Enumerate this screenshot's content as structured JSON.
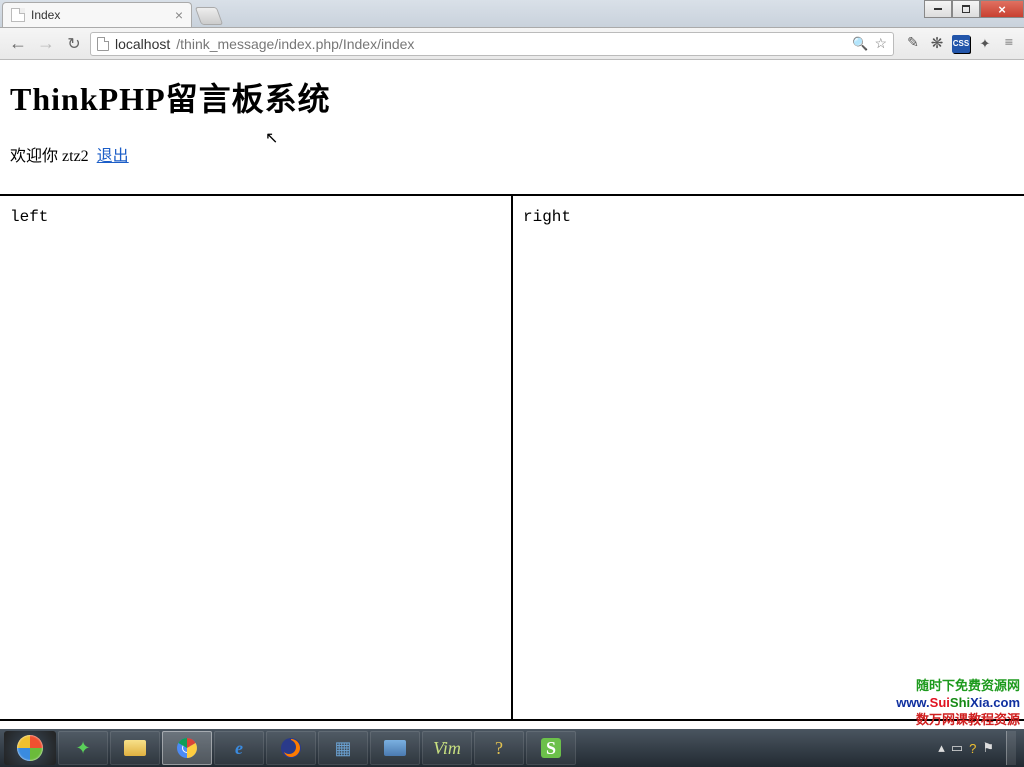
{
  "window": {
    "min_label": "minimize",
    "max_label": "maximize",
    "close_label": "close"
  },
  "tab": {
    "title": "Index"
  },
  "url": {
    "host": "localhost",
    "path": "/think_message/index.php/Index/index"
  },
  "ext": {
    "css_badge": "CSS"
  },
  "page": {
    "title": "ThinkPHP留言板系统",
    "welcome_prefix": "欢迎你 ",
    "username": "ztz2",
    "logout": "退出",
    "left_label": "left",
    "right_label": "right"
  },
  "watermark": {
    "line1": "随时下免费资源网",
    "line2_parts": [
      "www.",
      "Sui",
      "Shi",
      "Xia",
      ".com"
    ],
    "line3": "数万网课教程资源"
  },
  "tray": {
    "time": ""
  }
}
